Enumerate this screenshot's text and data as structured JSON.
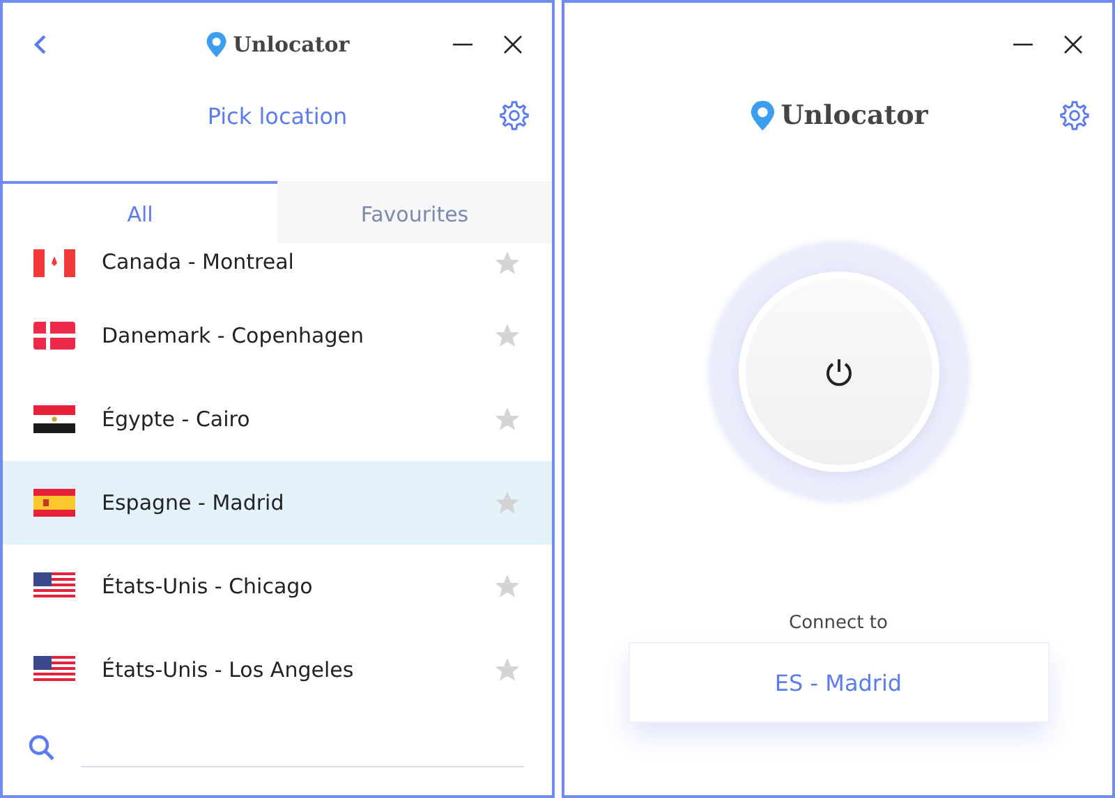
{
  "location_window": {
    "brand": "Unlocator",
    "title": "Pick location",
    "tabs": [
      {
        "label": "All",
        "selected": true
      },
      {
        "label": "Favourites",
        "selected": false
      }
    ],
    "locations": [
      {
        "name": "Canada - Montreal",
        "kind": "ca",
        "selected": false,
        "favourite": false
      },
      {
        "name": "Danemark - Copenhagen",
        "kind": "dk",
        "selected": false,
        "favourite": false
      },
      {
        "name": "Égypte - Cairo",
        "kind": "eg",
        "selected": false,
        "favourite": false
      },
      {
        "name": "Espagne - Madrid",
        "kind": "es",
        "selected": true,
        "favourite": false
      },
      {
        "name": "États-Unis - Chicago",
        "kind": "us",
        "selected": false,
        "favourite": false
      },
      {
        "name": "États-Unis - Los Angeles",
        "kind": "us",
        "selected": false,
        "favourite": false
      }
    ]
  },
  "connect_window": {
    "brand": "Unlocator",
    "connect_label": "Connect to",
    "location": "ES - Madrid"
  }
}
